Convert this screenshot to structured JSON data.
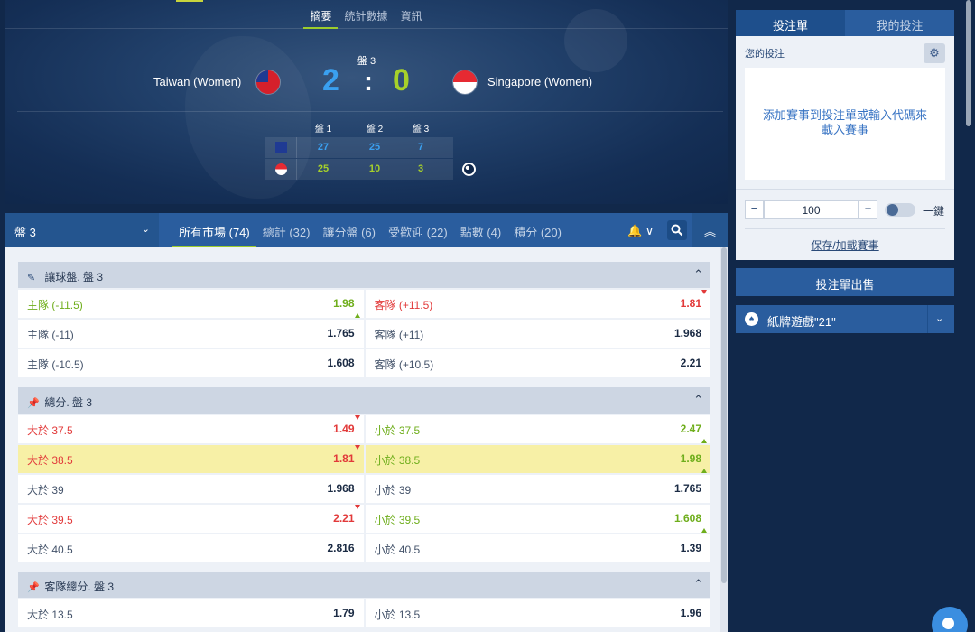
{
  "hero": {
    "tabs": [
      "摘要",
      "統計數據",
      "資訊"
    ],
    "set_label": "盤 3",
    "home_team": "Taiwan (Women)",
    "away_team": "Singapore (Women)",
    "home_score": "2",
    "away_score": "0",
    "colon": ":",
    "set_headers": [
      "盤 1",
      "盤 2",
      "盤 3"
    ],
    "home_sets": [
      "27",
      "25",
      "7"
    ],
    "away_sets": [
      "25",
      "10",
      "3"
    ],
    "home_color": "#3aa0f0",
    "away_color": "#a6d12a"
  },
  "market_bar": {
    "set_select": "盤 3",
    "tabs": [
      "所有市場 (74)",
      "總計 (32)",
      "讓分盤 (6)",
      "受歡迎 (22)",
      "點數 (4)",
      "積分 (20)"
    ],
    "bell": "🔔 ∨"
  },
  "markets": [
    {
      "title": "讓球盤. 盤 3",
      "pin_icon": "pin-icon",
      "rows": [
        [
          {
            "label": "主隊 (-11.5)",
            "odd": "1.98",
            "trend": "up"
          },
          {
            "label": "客隊 (+11.5)",
            "odd": "1.81",
            "trend": "down"
          }
        ],
        [
          {
            "label": "主隊 (-11)",
            "odd": "1.765",
            "trend": ""
          },
          {
            "label": "客隊 (+11)",
            "odd": "1.968",
            "trend": ""
          }
        ],
        [
          {
            "label": "主隊 (-10.5)",
            "odd": "1.608",
            "trend": ""
          },
          {
            "label": "客隊 (+10.5)",
            "odd": "2.21",
            "trend": ""
          }
        ]
      ]
    },
    {
      "title": "總分. 盤 3",
      "pin_icon": "pin-icon",
      "rows": [
        [
          {
            "label": "大於 37.5",
            "odd": "1.49",
            "trend": "down"
          },
          {
            "label": "小於 37.5",
            "odd": "2.47",
            "trend": "up"
          }
        ],
        [
          {
            "label": "大於 38.5",
            "odd": "1.81",
            "trend": "down",
            "highlight": true
          },
          {
            "label": "小於 38.5",
            "odd": "1.98",
            "trend": "up",
            "highlight": true
          }
        ],
        [
          {
            "label": "大於 39",
            "odd": "1.968",
            "trend": ""
          },
          {
            "label": "小於 39",
            "odd": "1.765",
            "trend": ""
          }
        ],
        [
          {
            "label": "大於 39.5",
            "odd": "2.21",
            "trend": "down"
          },
          {
            "label": "小於 39.5",
            "odd": "1.608",
            "trend": "up"
          }
        ],
        [
          {
            "label": "大於 40.5",
            "odd": "2.816",
            "trend": ""
          },
          {
            "label": "小於 40.5",
            "odd": "1.39",
            "trend": ""
          }
        ]
      ]
    },
    {
      "title": "客隊總分. 盤 3",
      "pin_icon": "pin-icon",
      "rows": [
        [
          {
            "label": "大於 13.5",
            "odd": "1.79",
            "trend": ""
          },
          {
            "label": "小於 13.5",
            "odd": "1.96",
            "trend": ""
          }
        ]
      ]
    }
  ],
  "betslip": {
    "tabs": [
      "投注單",
      "我的投注"
    ],
    "my_bets_label": "您的投注",
    "empty_text": "添加賽事到投注單或輸入代碼來載入賽事",
    "stake_value": "100",
    "minus": "−",
    "plus": "+",
    "one_click": "一鍵",
    "save_link": "保存/加載賽事",
    "cashout": "投注單出售",
    "blackjack": "紙牌遊戲\"21\""
  }
}
